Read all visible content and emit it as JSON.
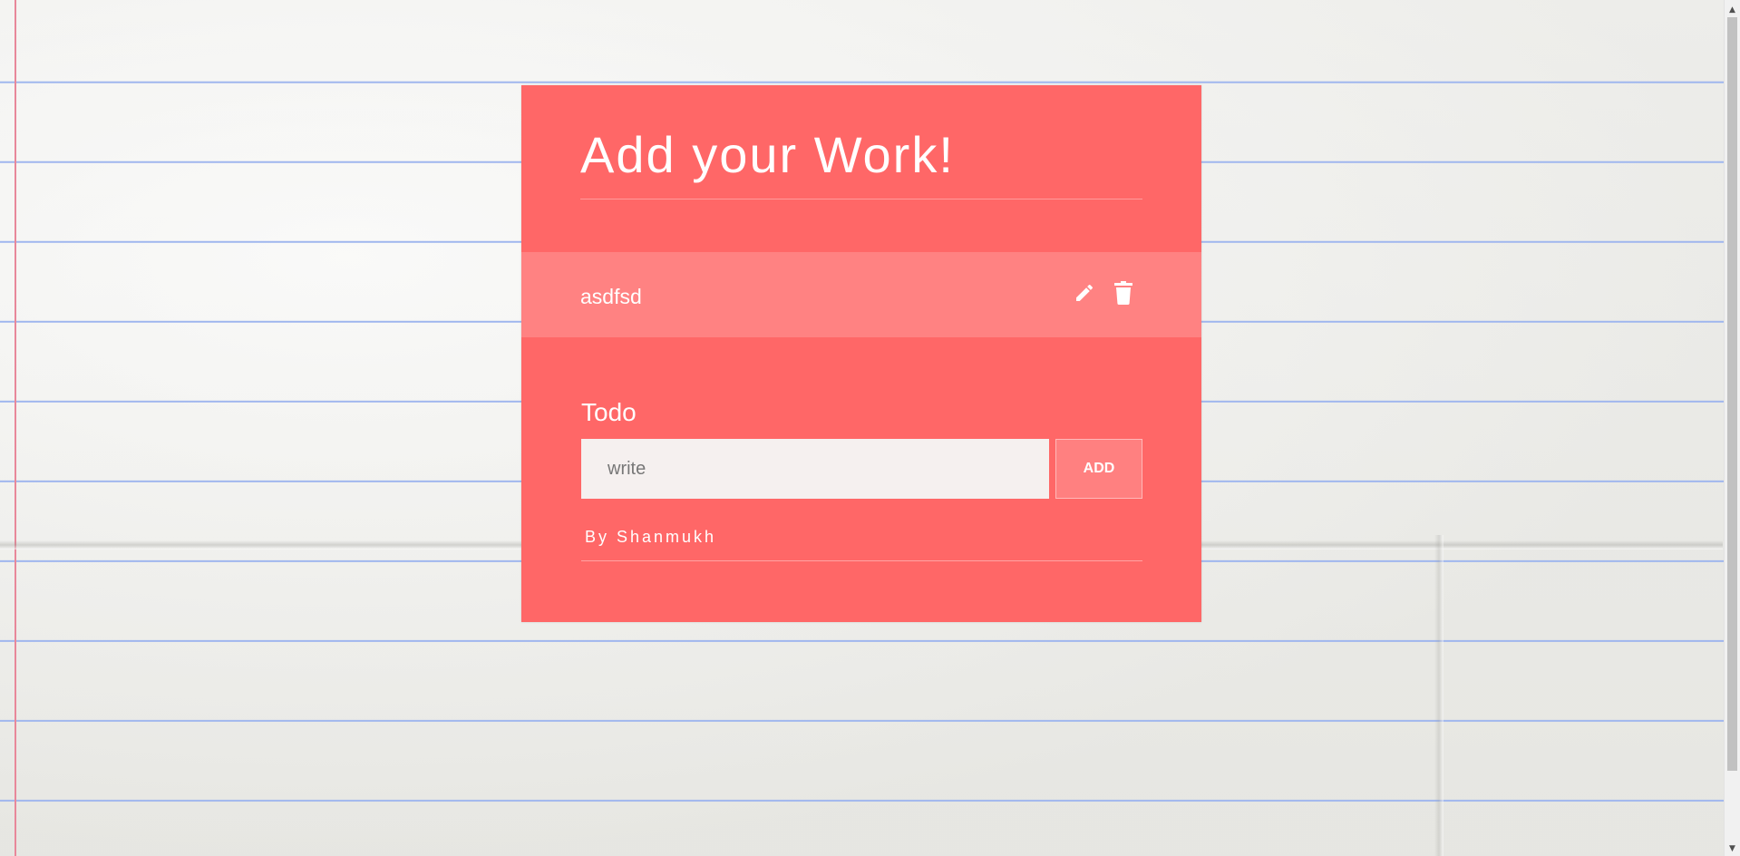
{
  "card": {
    "title": "Add your Work!",
    "background_color": "#ff6767",
    "item_background_color": "#ff8282"
  },
  "items": [
    {
      "text": "asdfsd",
      "edit_icon": "pencil-icon",
      "delete_icon": "trash-icon"
    }
  ],
  "form": {
    "label": "Todo",
    "input_value": "",
    "input_placeholder": "write",
    "add_button_label": "ADD"
  },
  "credit": "By Shanmukh",
  "scrollbar": {
    "up_icon": "arrow-up-icon",
    "down_icon": "arrow-down-icon"
  }
}
